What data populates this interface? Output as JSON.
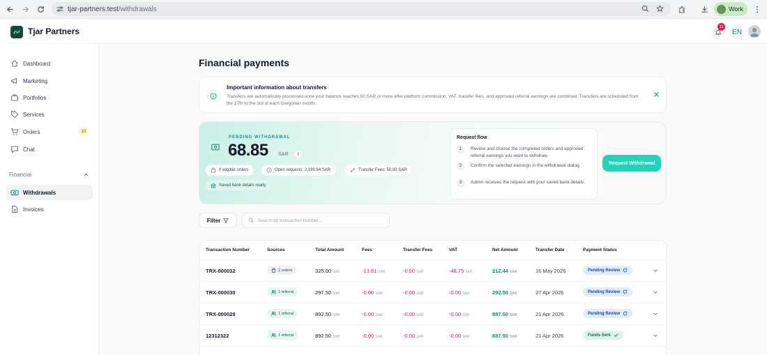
{
  "browser": {
    "url_prefix": "tjar-partners.test",
    "url_path": "/withdrawals",
    "profile_label": "Work"
  },
  "app": {
    "brand": "Tjar Partners",
    "notification_count": "11",
    "language": "EN"
  },
  "sidebar": {
    "items": [
      {
        "label": "Dashboard",
        "icon": "home-icon"
      },
      {
        "label": "Marketing",
        "icon": "megaphone-icon"
      },
      {
        "label": "Portfolios",
        "icon": "portfolio-icon"
      },
      {
        "label": "Services",
        "icon": "tag-icon"
      },
      {
        "label": "Orders",
        "icon": "cart-icon",
        "count": "10"
      },
      {
        "label": "Chat",
        "icon": "chat-icon"
      }
    ],
    "section_label": "Financial",
    "financial_items": [
      {
        "label": "Withdrawals",
        "icon": "cash-icon",
        "active": true
      },
      {
        "label": "Invoices",
        "icon": "document-icon"
      }
    ]
  },
  "page": {
    "title": "Financial payments"
  },
  "info_banner": {
    "title": "Important information about transfers",
    "text": "Transfers are automatically processed once your balance reaches 50 SAR or more after platform commission, VAT, transfer fees, and approved referral earnings are combined. Transfers are scheduled from the 27th to the 3rd of each Gregorian month."
  },
  "withdrawal": {
    "label": "PENDING WITHDRAWAL",
    "amount": "68.85",
    "currency": "SAR",
    "info_icon": "i",
    "eligible_orders": "0 eligible orders",
    "open_requests": "Open requests: 2,199.94 SAR",
    "transfer_fees": "Transfer Fees: 50.00 SAR",
    "bank_status": "Saved bank details ready",
    "request_button": "Request Withdrawal"
  },
  "request_flow": {
    "title": "Request flow",
    "steps": [
      {
        "n": "1",
        "text": "Review and choose the completed orders and approved referral earnings you want to withdraw."
      },
      {
        "n": "2",
        "text": "Confirm the selected earnings in the withdrawal dialog."
      },
      {
        "n": "3",
        "text": "Admin receives the request with your saved bank details."
      }
    ]
  },
  "toolbar": {
    "filter_label": "Filter",
    "search_placeholder": "Search by transaction number..."
  },
  "table": {
    "columns": [
      "Transaction Number",
      "Sources",
      "Total Amount",
      "Fees",
      "Transfer Fees",
      "VAT",
      "Net Amount",
      "Transfer Date",
      "Payment Status"
    ],
    "currency": "SAR",
    "rows": [
      {
        "id": "TRX-000032",
        "source": "2 orders",
        "source_type": "orders",
        "total": "325.00",
        "fees": "-13.81",
        "transfer_fees": "-0.00",
        "vat": "-48.75",
        "net": "212.44",
        "date": "16 May 2026",
        "status": "Pending Review",
        "status_type": "pending"
      },
      {
        "id": "TRX-000030",
        "source": "1 referral",
        "source_type": "referral",
        "total": "297.50",
        "fees": "-0.00",
        "transfer_fees": "-0.00",
        "vat": "-0.00",
        "net": "292.50",
        "date": "27 Apr 2026",
        "status": "Pending Review",
        "status_type": "pending"
      },
      {
        "id": "TRX-000029",
        "source": "1 referral",
        "source_type": "referral",
        "total": "892.50",
        "fees": "-0.00",
        "transfer_fees": "-0.00",
        "vat": "-0.00",
        "net": "887.50",
        "date": "21 Apr 2026",
        "status": "Pending Review",
        "status_type": "pending"
      },
      {
        "id": "12312322",
        "source": "1 referral",
        "source_type": "referral",
        "total": "892.50",
        "fees": "-0.00",
        "transfer_fees": "-0.00",
        "vat": "-0.00",
        "net": "887.50",
        "date": "21 Apr 2026",
        "status": "Funds Sent",
        "status_type": "sent"
      }
    ]
  },
  "colors": {
    "accent": "#22d3b8",
    "teal": "#0d9488",
    "negative": "#e11d48",
    "positive": "#059669"
  }
}
